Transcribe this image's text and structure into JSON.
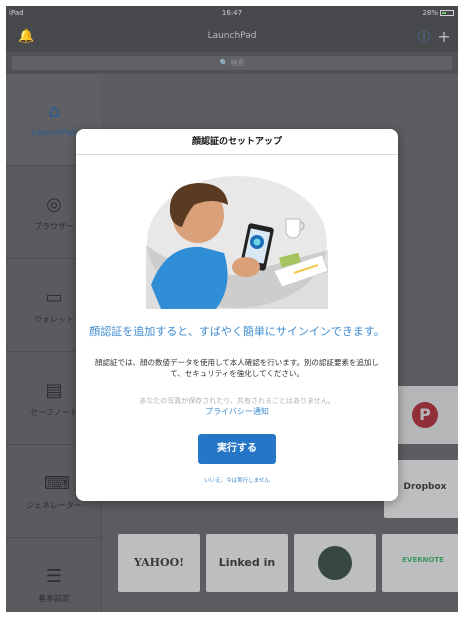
{
  "status_bar": {
    "carrier": "iPad",
    "time": "16:47",
    "battery": "28%"
  },
  "nav": {
    "title": "LaunchPad"
  },
  "search": {
    "placeholder": "検索"
  },
  "sidebar": {
    "items": [
      {
        "label": "LaunchPad",
        "icon": "launchpad-icon"
      },
      {
        "label": "ブラウザー",
        "icon": "globe-icon"
      },
      {
        "label": "ウォレット",
        "icon": "wallet-icon"
      },
      {
        "label": "セーフノート",
        "icon": "note-icon"
      },
      {
        "label": "ジェネレーター",
        "icon": "generator-icon"
      },
      {
        "label": "基本設定",
        "icon": "settings-sliders-icon"
      }
    ]
  },
  "tiles": [
    {
      "label": "",
      "brand": "pinterest"
    },
    {
      "label": "Dropbox",
      "brand": "dropbox"
    },
    {
      "label": "YAHOO!",
      "brand": "yahoo"
    },
    {
      "label": "Linked in",
      "brand": "linkedin"
    },
    {
      "label": "",
      "brand": "starbucks"
    },
    {
      "label": "EVERNOTE",
      "brand": "evernote"
    }
  ],
  "modal": {
    "title": "顔認証のセットアップ",
    "headline": "顔認証を追加すると、すばやく簡単にサインインできます。",
    "description": "顔認証では、顔の数値データを使用して本人確認を行います。別の認証要素を追加して、セキュリティを強化してください。",
    "note": "あなたの写真が保存されたり、共有されることはありません。",
    "privacy_link": "プライバシー通知",
    "primary_button": "実行する",
    "secondary_link": "いいえ、今は実行しません"
  },
  "colors": {
    "accent": "#2576c7",
    "link": "#3d8bd0",
    "pinterest": "#bd081c",
    "linkedin": "#0077b5"
  }
}
